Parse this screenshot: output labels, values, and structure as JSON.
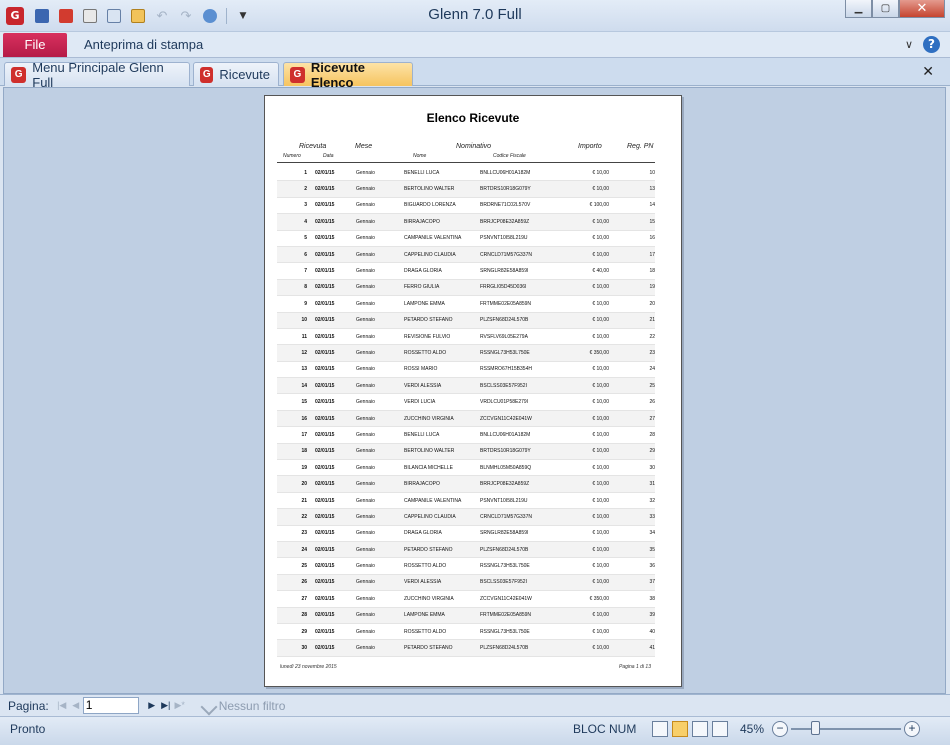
{
  "app": {
    "title": "Glenn 7.0 Full",
    "logo_letter": "G"
  },
  "ribbon": {
    "file_label": "File",
    "tab_label": "Anteprima di stampa",
    "help_label": "?",
    "collapse_label": "∨"
  },
  "doc_tabs": [
    {
      "label": "Menu Principale Glenn Full"
    },
    {
      "label": "Ricevute"
    },
    {
      "label": "Ricevute  Elenco"
    }
  ],
  "report": {
    "title": "Elenco Ricevute",
    "headers": {
      "ricevuta": "Ricevuta",
      "numero": "Numero",
      "data": "Data",
      "mese": "Mese",
      "nominativo": "Nominativo",
      "nome": "Nome",
      "codice_fiscale": "Codice Fiscale",
      "importo": "Importo",
      "reg_pn": "Reg. PN"
    },
    "rows": [
      {
        "n": "1",
        "data": "02/01/15",
        "mese": "Gennaio",
        "nome": "BENELLI LUCA",
        "cf": "BNLLCU06H01A182M",
        "importo": "€ 10,00",
        "reg": "10"
      },
      {
        "n": "2",
        "data": "02/01/15",
        "mese": "Gennaio",
        "nome": "BERTOLINO WALTER",
        "cf": "BRTDRS10R18G079Y",
        "importo": "€ 10,00",
        "reg": "13"
      },
      {
        "n": "3",
        "data": "02/01/15",
        "mese": "Gennaio",
        "nome": "BIGUARDO LORENZA",
        "cf": "BRDRNE71C02L570V",
        "importo": "€ 100,00",
        "reg": "14"
      },
      {
        "n": "4",
        "data": "02/01/15",
        "mese": "Gennaio",
        "nome": "BIRRAJACOPO",
        "cf": "BRRJCP08E32A859Z",
        "importo": "€ 10,00",
        "reg": "15"
      },
      {
        "n": "5",
        "data": "02/01/15",
        "mese": "Gennaio",
        "nome": "CAMPANILE VALENTINA",
        "cf": "PSNVNT10I58L219U",
        "importo": "€ 10,00",
        "reg": "16"
      },
      {
        "n": "6",
        "data": "02/01/15",
        "mese": "Gennaio",
        "nome": "CAPPELINO CLAUDIA",
        "cf": "CRNCLD71M57G337N",
        "importo": "€ 10,00",
        "reg": "17"
      },
      {
        "n": "7",
        "data": "02/01/15",
        "mese": "Gennaio",
        "nome": "DRAGA GLORIA",
        "cf": "SRNGLR82E58A859I",
        "importo": "€ 40,00",
        "reg": "18"
      },
      {
        "n": "8",
        "data": "02/01/15",
        "mese": "Gennaio",
        "nome": "FERRO GIULIA",
        "cf": "FRRGLI05D45D036I",
        "importo": "€ 10,00",
        "reg": "19"
      },
      {
        "n": "9",
        "data": "02/01/15",
        "mese": "Gennaio",
        "nome": "LAMPONE EMMA",
        "cf": "FRTMME02E05A859N",
        "importo": "€ 10,00",
        "reg": "20"
      },
      {
        "n": "10",
        "data": "02/01/15",
        "mese": "Gennaio",
        "nome": "PETARDO STEFANO",
        "cf": "PLZSFN68D24L570B",
        "importo": "€ 10,00",
        "reg": "21"
      },
      {
        "n": "11",
        "data": "02/01/15",
        "mese": "Gennaio",
        "nome": "REVISIONE FULVIO",
        "cf": "RVSFLV69L05E279A",
        "importo": "€ 10,00",
        "reg": "22"
      },
      {
        "n": "12",
        "data": "02/01/15",
        "mese": "Gennaio",
        "nome": "ROSSETTO ALDO",
        "cf": "RSSNGL73H53L750E",
        "importo": "€ 350,00",
        "reg": "23"
      },
      {
        "n": "13",
        "data": "02/01/15",
        "mese": "Gennaio",
        "nome": "ROSSI MARIO",
        "cf": "RSSMRO67H15B354H",
        "importo": "€ 10,00",
        "reg": "24"
      },
      {
        "n": "14",
        "data": "02/01/15",
        "mese": "Gennaio",
        "nome": "VERDI ALESSIA",
        "cf": "BSCLSS03E57F952I",
        "importo": "€ 10,00",
        "reg": "25"
      },
      {
        "n": "15",
        "data": "02/01/15",
        "mese": "Gennaio",
        "nome": "VERDI LUCIA",
        "cf": "VRDLCU01P58E279I",
        "importo": "€ 10,00",
        "reg": "26"
      },
      {
        "n": "16",
        "data": "02/01/15",
        "mese": "Gennaio",
        "nome": "ZUCCHINO VIRGINIA",
        "cf": "ZCCVGN11C42E041W",
        "importo": "€ 10,00",
        "reg": "27"
      },
      {
        "n": "17",
        "data": "02/01/15",
        "mese": "Gennaio",
        "nome": "BENELLI LUCA",
        "cf": "BNLLCU06H01A182M",
        "importo": "€ 10,00",
        "reg": "28"
      },
      {
        "n": "18",
        "data": "02/01/15",
        "mese": "Gennaio",
        "nome": "BERTOLINO WALTER",
        "cf": "BRTDRS10R18G079Y",
        "importo": "€ 10,00",
        "reg": "29"
      },
      {
        "n": "19",
        "data": "02/01/15",
        "mese": "Gennaio",
        "nome": "BILANCIA MICHELLE",
        "cf": "BLNMHL05M50A859Q",
        "importo": "€ 10,00",
        "reg": "30"
      },
      {
        "n": "20",
        "data": "02/01/15",
        "mese": "Gennaio",
        "nome": "BIRRAJACOPO",
        "cf": "BRRJCP08E32A859Z",
        "importo": "€ 10,00",
        "reg": "31"
      },
      {
        "n": "21",
        "data": "02/01/15",
        "mese": "Gennaio",
        "nome": "CAMPANILE VALENTINA",
        "cf": "PSNVNT10I58L219U",
        "importo": "€ 10,00",
        "reg": "32"
      },
      {
        "n": "22",
        "data": "02/01/15",
        "mese": "Gennaio",
        "nome": "CAPPELINO CLAUDIA",
        "cf": "CRNCLD71M57G337N",
        "importo": "€ 10,00",
        "reg": "33"
      },
      {
        "n": "23",
        "data": "02/01/15",
        "mese": "Gennaio",
        "nome": "DRAGA GLORIA",
        "cf": "SRNGLR82E58A859I",
        "importo": "€ 10,00",
        "reg": "34"
      },
      {
        "n": "24",
        "data": "02/01/15",
        "mese": "Gennaio",
        "nome": "PETARDO STEFANO",
        "cf": "PLZSFN68D24L570B",
        "importo": "€ 10,00",
        "reg": "35"
      },
      {
        "n": "25",
        "data": "02/01/15",
        "mese": "Gennaio",
        "nome": "ROSSETTO ALDO",
        "cf": "RSSNGL73H53L750E",
        "importo": "€ 10,00",
        "reg": "36"
      },
      {
        "n": "26",
        "data": "02/01/15",
        "mese": "Gennaio",
        "nome": "VERDI ALESSIA",
        "cf": "BSCLSS03E57F952I",
        "importo": "€ 10,00",
        "reg": "37"
      },
      {
        "n": "27",
        "data": "02/01/15",
        "mese": "Gennaio",
        "nome": "ZUCCHINO VIRGINIA",
        "cf": "ZCCVGN11C42E041W",
        "importo": "€ 350,00",
        "reg": "38"
      },
      {
        "n": "28",
        "data": "02/01/15",
        "mese": "Gennaio",
        "nome": "LAMPONE EMMA",
        "cf": "FRTMME02E05A859N",
        "importo": "€ 10,00",
        "reg": "39"
      },
      {
        "n": "29",
        "data": "02/01/15",
        "mese": "Gennaio",
        "nome": "ROSSETTO ALDO",
        "cf": "RSSNGL73H53L750E",
        "importo": "€ 10,00",
        "reg": "40"
      },
      {
        "n": "30",
        "data": "02/01/15",
        "mese": "Gennaio",
        "nome": "PETARDO STEFANO",
        "cf": "PLZSFN68D24L570B",
        "importo": "€ 10,00",
        "reg": "41"
      }
    ],
    "footer_left": "lunedì 23 novembre 2015",
    "footer_right": "Pagina 1 di 13"
  },
  "navigation": {
    "page_label": "Pagina:",
    "page_value": "1",
    "filter_label": "Nessun filtro"
  },
  "status": {
    "text": "Pronto",
    "bloc_num": "BLOC NUM",
    "zoom": "45%",
    "zoom_level_fraction": 0.2
  }
}
